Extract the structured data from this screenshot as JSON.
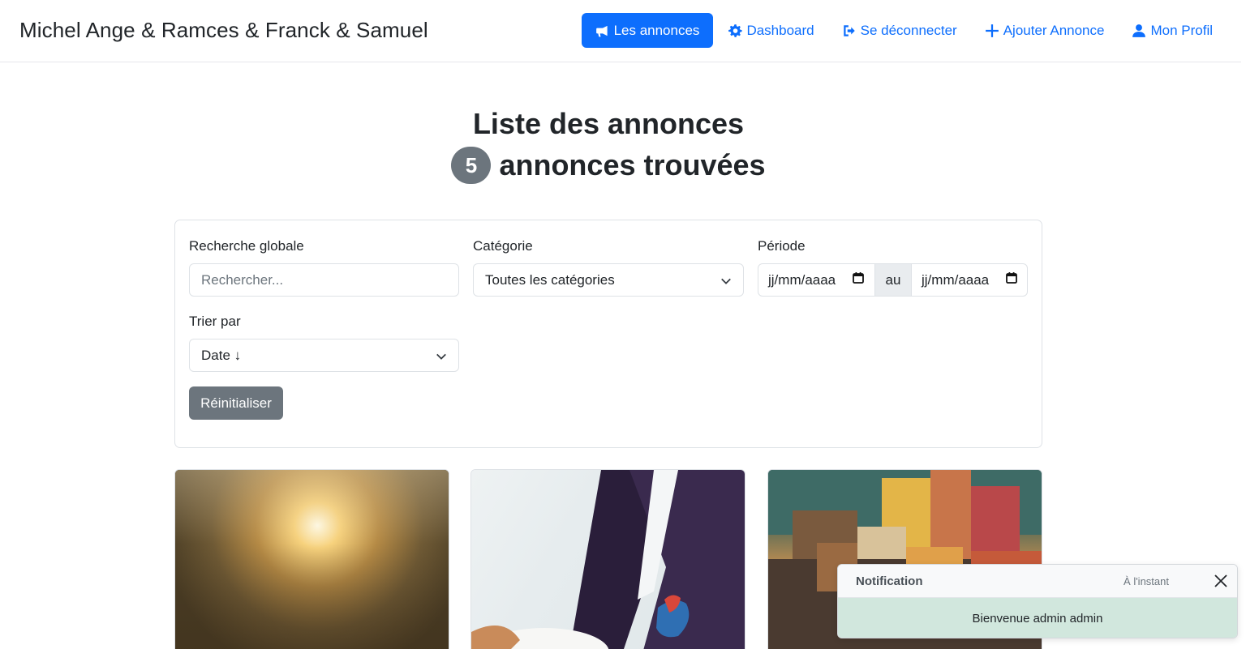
{
  "brand": "Michel Ange & Ramces & Franck & Samuel",
  "nav": {
    "announcements": "Les annonces",
    "dashboard": "Dashboard",
    "logout": "Se déconnecter",
    "add": "Ajouter Annonce",
    "profile": "Mon Profil"
  },
  "page": {
    "title": "Liste des annonces",
    "count": "5",
    "count_label": "annonces trouvées"
  },
  "filters": {
    "search_label": "Recherche globale",
    "search_placeholder": "Rechercher...",
    "category_label": "Catégorie",
    "category_value": "Toutes les catégories",
    "period_label": "Période",
    "date_from": "jj/mm/aaaa",
    "date_sep": "au",
    "date_to": "jj/mm/aaaa",
    "sort_label": "Trier par",
    "sort_value": "Date ↓",
    "reset": "Réinitialiser"
  },
  "toast": {
    "title": "Notification",
    "time": "À l'instant",
    "message": "Bienvenue admin admin"
  },
  "colors": {
    "primary": "#0d6efd",
    "secondary": "#6c757d",
    "success_bg": "#d1e7dd"
  }
}
